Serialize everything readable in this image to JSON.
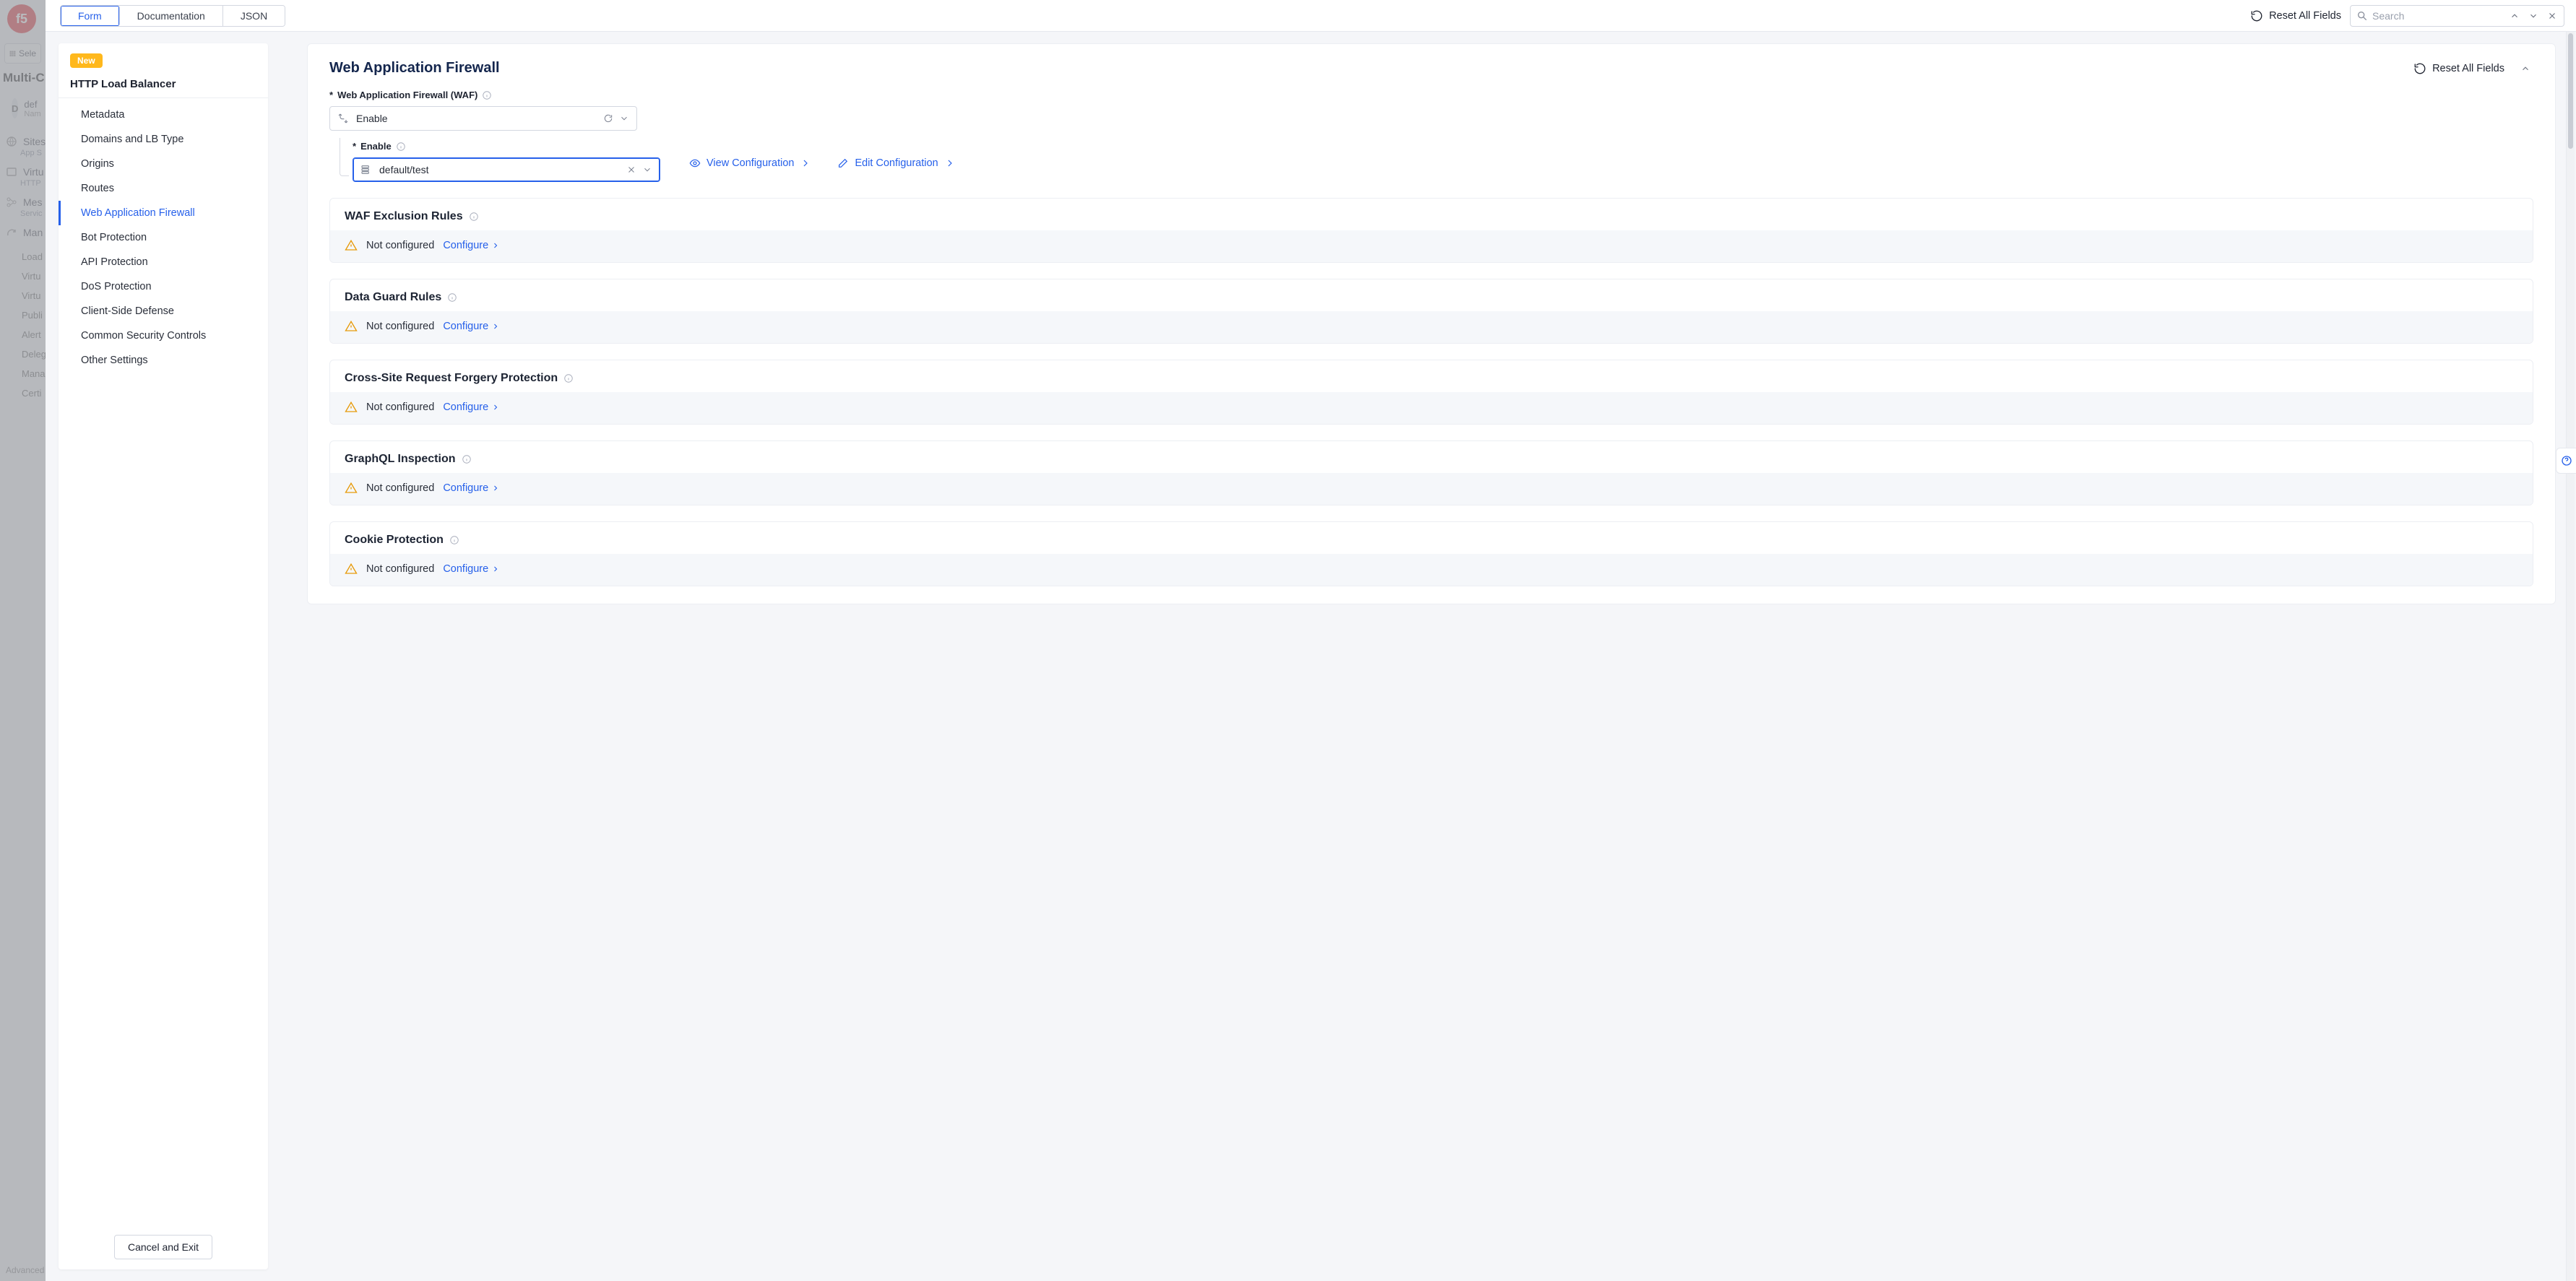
{
  "backdrop": {
    "select_label": "Sele",
    "app_title": "Multi-C",
    "tenant_badge": "D",
    "tenant_name": "def",
    "tenant_sub": "Nam",
    "nav": [
      {
        "label": "Sites",
        "sub": "App S"
      },
      {
        "label": "Virtu",
        "sub": "HTTP"
      },
      {
        "label": "Mes",
        "sub": "Servic"
      },
      {
        "label": "Man",
        "sub": ""
      }
    ],
    "nav_plain": [
      "Load",
      "Virtu",
      "Virtu",
      "Publi",
      "Alert",
      "Deleg",
      "Mana",
      "Certi"
    ],
    "footer": "Advanced"
  },
  "topbar": {
    "tabs": [
      "Form",
      "Documentation",
      "JSON"
    ],
    "active_tab": 0,
    "reset_label": "Reset All Fields",
    "search_placeholder": "Search"
  },
  "sidebar": {
    "badge": "New",
    "title": "HTTP Load Balancer",
    "items": [
      "Metadata",
      "Domains and LB Type",
      "Origins",
      "Routes",
      "Web Application Firewall",
      "Bot Protection",
      "API Protection",
      "DoS Protection",
      "Client-Side Defense",
      "Common Security Controls",
      "Other Settings"
    ],
    "active_index": 4,
    "cancel_label": "Cancel and Exit"
  },
  "main": {
    "title": "Web Application Firewall",
    "reset_label": "Reset All Fields",
    "waf_label": "Web Application Firewall (WAF)",
    "waf_value": "Enable",
    "enable_label": "Enable",
    "enable_value": "default/test",
    "actions": {
      "view": "View Configuration",
      "edit": "Edit Configuration"
    },
    "subcards": [
      {
        "title": "WAF Exclusion Rules",
        "status": "Not configured",
        "link": "Configure"
      },
      {
        "title": "Data Guard Rules",
        "status": "Not configured",
        "link": "Configure"
      },
      {
        "title": "Cross-Site Request Forgery Protection",
        "status": "Not configured",
        "link": "Configure"
      },
      {
        "title": "GraphQL Inspection",
        "status": "Not configured",
        "link": "Configure"
      },
      {
        "title": "Cookie Protection",
        "status": "Not configured",
        "link": "Configure"
      }
    ]
  }
}
